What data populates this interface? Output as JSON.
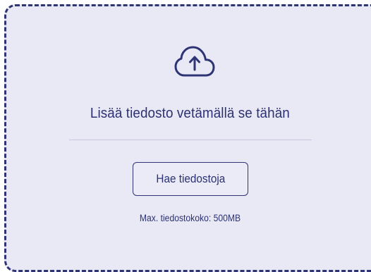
{
  "dropzone": {
    "icon": "cloud-upload-icon",
    "title": "Lisää tiedosto vetämällä se tähän",
    "browse_button_label": "Hae tiedostoja",
    "max_size_text": "Max. tiedostokoko: 500MB"
  },
  "colors": {
    "background": "#e9e9f6",
    "accent": "#2e3474",
    "divider": "#c6c7df"
  }
}
